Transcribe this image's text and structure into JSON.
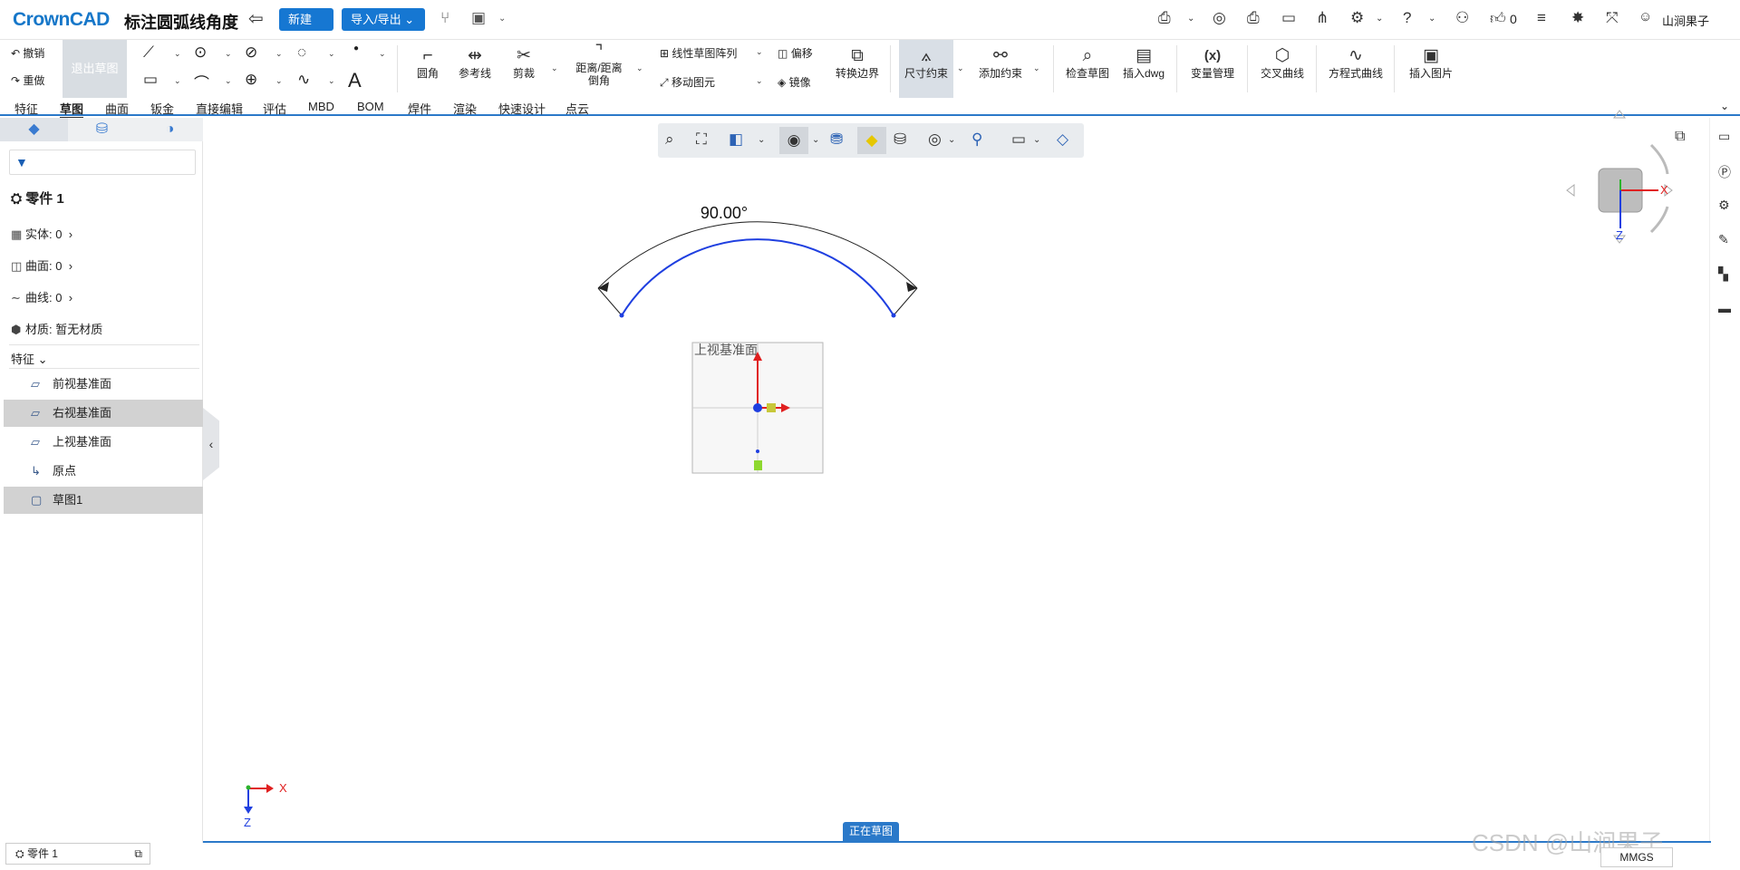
{
  "app": {
    "logo": "CrownCAD",
    "doc_title": "标注圆弧线角度"
  },
  "titlebar": {
    "new_btn": "新建 ⌄",
    "io_btn": "导入/导出 ⌄",
    "like_count": "0",
    "user": "山涧果子"
  },
  "ribbon": {
    "undo": "撤销",
    "redo": "重做",
    "exit_sketch": "退出草图",
    "fillet": "圆角",
    "ref_line": "参考线",
    "trim": "剪裁",
    "chamfer_line1": "距离/距离",
    "chamfer_line2": "倒角",
    "linear_pattern": "线性草图阵列",
    "move_entity": "移动图元",
    "offset": "偏移",
    "mirror": "镜像",
    "convert_edge": "转换边界",
    "smart_dim": "尺寸约束",
    "add_constraint": "添加约束",
    "check_sketch": "检查草图",
    "insert_dwg": "插入dwg",
    "variables": "变量管理",
    "cross_curve": "交叉曲线",
    "equation_curve": "方程式曲线",
    "insert_image": "插入图片",
    "text_tool": "A"
  },
  "tabs": [
    "特征",
    "草图",
    "曲面",
    "钣金",
    "直接编辑",
    "评估",
    "MBD",
    "BOM",
    "焊件",
    "渲染",
    "快速设计",
    "点云"
  ],
  "active_tab": "草图",
  "tree": {
    "part": "零件 1",
    "solid": "实体: 0",
    "surface": "曲面: 0",
    "curve": "曲线: 0",
    "material": "材质: 暂无材质",
    "features_header": "特征",
    "items": [
      "前视基准面",
      "右视基准面",
      "上视基准面",
      "原点",
      "草图1"
    ]
  },
  "canvas": {
    "dimension_text": "90.00°",
    "plane_label": "上视基准面",
    "axis_x": "X",
    "axis_z": "Z",
    "sketching": "正在草图"
  },
  "status": {
    "part_tab": "零件 1",
    "units": "MMGS"
  },
  "watermark": "CSDN @山涧果子",
  "colors": {
    "accent": "#1677d2",
    "arc": "#1f3fe0",
    "axis_x": "#e02020",
    "axis_y": "#e02020",
    "axis_z": "#1f3fe0"
  }
}
